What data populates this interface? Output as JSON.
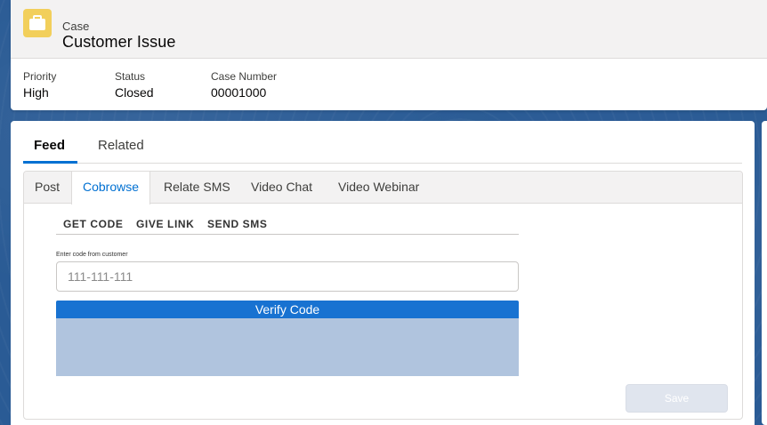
{
  "header": {
    "object_type": "Case",
    "title": "Customer Issue",
    "icon": "briefcase-icon",
    "icon_color": "#f2cf5b",
    "fields": {
      "priority": {
        "label": "Priority",
        "value": "High"
      },
      "status": {
        "label": "Status",
        "value": "Closed"
      },
      "case_number": {
        "label": "Case Number",
        "value": "00001000"
      }
    }
  },
  "tabs": {
    "feed": "Feed",
    "related": "Related",
    "active": "Feed"
  },
  "publisher": {
    "tabs": {
      "post": "Post",
      "cobrowse": "Cobrowse",
      "relate_sms": "Relate SMS",
      "video_chat": "Video Chat",
      "video_webinar": "Video Webinar"
    },
    "active_tab": "Cobrowse",
    "actions": {
      "get_code": "GET CODE",
      "give_link": "GIVE LINK",
      "send_sms": "SEND SMS"
    },
    "code_label": "Enter code from customer",
    "code_placeholder": "111-111-111",
    "code_value": "",
    "verify_label": "Verify Code",
    "save_label": "Save"
  },
  "colors": {
    "accent": "#0070d2",
    "verify_button": "#1872d1",
    "background": "#2a5b95"
  }
}
